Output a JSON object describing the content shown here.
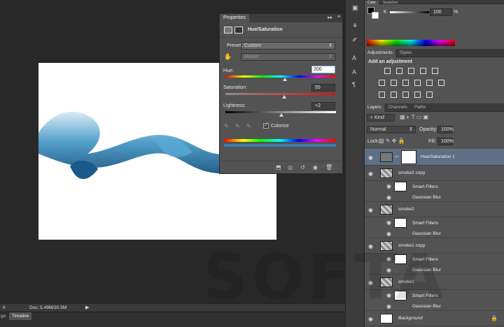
{
  "properties": {
    "tab": "Properties",
    "title": "Hue/Saturation",
    "preset_label": "Preset:",
    "preset_value": "Custom",
    "channel_value": "Master",
    "hue_label": "Hue:",
    "hue_value": "200",
    "saturation_label": "Saturation:",
    "saturation_value": "55",
    "lightness_label": "Lightness:",
    "lightness_value": "+2",
    "colorize_label": "Colorize",
    "colorize_checked": true
  },
  "status": {
    "zoom": "6",
    "doc": "Doc: 5.49M/20.5M"
  },
  "timeline": {
    "tab": "Timeline",
    "left_fragment": "ge"
  },
  "color_panel": {
    "tab": "Color",
    "tab2": "Swatches",
    "k_label": "K",
    "k_value": "100",
    "unit": "%"
  },
  "adjustments": {
    "tab": "Adjustments",
    "tab2": "Styles",
    "heading": "Add an adjustment"
  },
  "layers_panel": {
    "tabs": [
      "Layers",
      "Channels",
      "Paths"
    ],
    "kind": "Kind",
    "blend_mode": "Normal",
    "opacity_label": "Opacity:",
    "opacity_value": "100%",
    "lock_label": "Lock:",
    "fill_label": "Fill:",
    "fill_value": "100%"
  },
  "layers": [
    {
      "name": "Hue/Saturation 1"
    },
    {
      "name": "smoke2 copy",
      "smart": "Smart Filters",
      "filter": "Gaussian Blur"
    },
    {
      "name": "smoke2",
      "smart": "Smart Filters",
      "filter": "Gaussian Blur"
    },
    {
      "name": "smoke1 copy",
      "smart": "Smart Filters",
      "filter": "Gaussian Blur"
    },
    {
      "name": "smoke1",
      "smart": "Smart Filters",
      "filter": "Gaussian Blur"
    },
    {
      "name": "Background"
    }
  ],
  "watermark": "SOFTA"
}
